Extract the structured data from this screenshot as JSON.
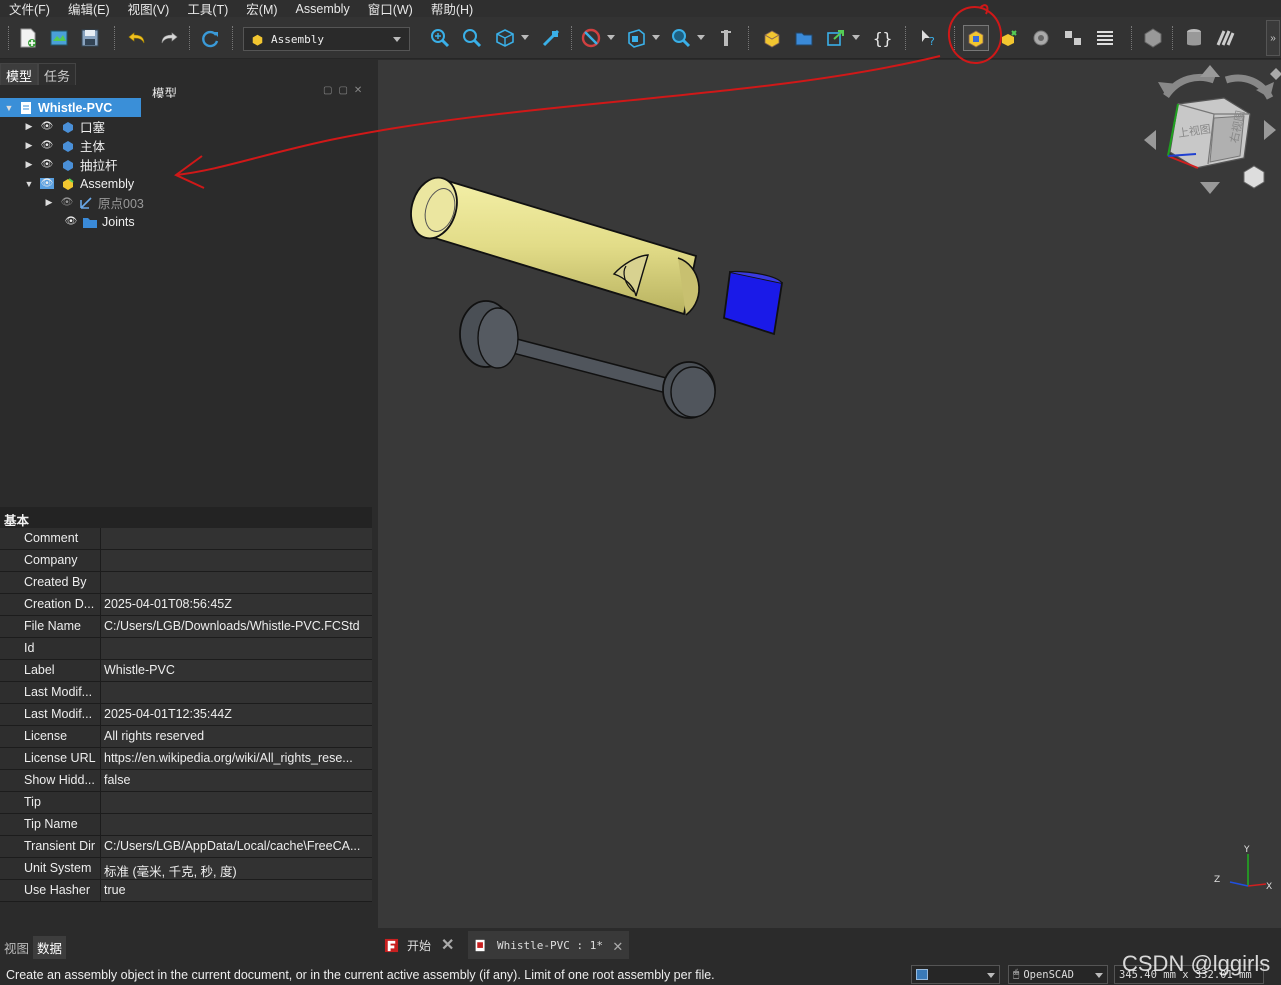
{
  "menus": [
    "文件(F)",
    "编辑(E)",
    "视图(V)",
    "工具(T)",
    "宏(M)",
    "Assembly",
    "窗口(W)",
    "帮助(H)"
  ],
  "workbench": "Assembly",
  "panel_tabs": [
    "模型",
    "任务"
  ],
  "tree_title": "模型",
  "tree": {
    "root": "Whistle-PVC",
    "items": [
      "口塞",
      "主体",
      "抽拉杆",
      "Assembly",
      "原点003",
      "Joints"
    ]
  },
  "props": {
    "group": "基本",
    "rows": [
      {
        "k": "Comment",
        "v": ""
      },
      {
        "k": "Company",
        "v": ""
      },
      {
        "k": "Created By",
        "v": ""
      },
      {
        "k": "Creation D...",
        "v": "2025-04-01T08:56:45Z"
      },
      {
        "k": "File Name",
        "v": "C:/Users/LGB/Downloads/Whistle-PVC.FCStd"
      },
      {
        "k": "Id",
        "v": ""
      },
      {
        "k": "Label",
        "v": "Whistle-PVC"
      },
      {
        "k": "Last Modif...",
        "v": ""
      },
      {
        "k": "Last Modif...",
        "v": "2025-04-01T12:35:44Z"
      },
      {
        "k": "License",
        "v": "All rights reserved"
      },
      {
        "k": "License URL",
        "v": "https://en.wikipedia.org/wiki/All_rights_rese..."
      },
      {
        "k": "Show Hidd...",
        "v": "false"
      },
      {
        "k": "Tip",
        "v": ""
      },
      {
        "k": "Tip Name",
        "v": ""
      },
      {
        "k": "Transient Dir",
        "v": "C:/Users/LGB/AppData/Local/cache\\FreeCA..."
      },
      {
        "k": "Unit System",
        "v": "标准 (毫米, 千克, 秒, 度)"
      },
      {
        "k": "Use Hasher",
        "v": "true"
      }
    ]
  },
  "bottom_tabs": [
    "视图",
    "数据"
  ],
  "doc_tabs": [
    "开始",
    "Whistle-PVC : 1*"
  ],
  "navcube": {
    "top": "上视图",
    "right": "右视图"
  },
  "axes": {
    "x": "X",
    "y": "Y",
    "z": "Z"
  },
  "status": {
    "message": "Create an assembly object in the current document, or in the current active assembly (if any). Limit of one root assembly per file.",
    "navstyle": "OpenSCAD",
    "dimensions": "345.40 mm x 332.01 mm"
  },
  "watermark": "CSDN @lggirls",
  "colors": {
    "accent": "#3a8fd8",
    "annotation": "#d01818",
    "tube": "#e5e08a",
    "cap": "#1a1ae8",
    "rod": "#4a4f55"
  }
}
